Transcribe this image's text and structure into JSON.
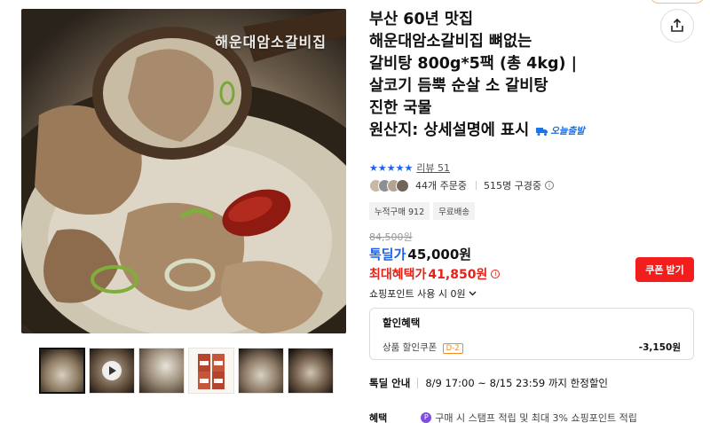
{
  "gallery": {
    "watermark": "해운대암소갈비집",
    "thumbnails": [
      {
        "name": "thumb-1",
        "active": true
      },
      {
        "name": "thumb-2-video",
        "active": false
      },
      {
        "name": "thumb-3",
        "active": false
      },
      {
        "name": "thumb-4",
        "active": false
      },
      {
        "name": "thumb-5",
        "active": false
      },
      {
        "name": "thumb-6",
        "active": false
      }
    ]
  },
  "product": {
    "title_lines": [
      "부산 60년 맛집",
      "해운대암소갈비집 뼈없는",
      "갈비탕 800g*5팩 (총 4kg) |",
      "살코기 듬뿍 순살 소 갈비탕",
      "진한 국물"
    ],
    "origin": "원산지: 상세설명에 표시",
    "today_badge": "오늘출발"
  },
  "rating": {
    "stars": "★★★★★",
    "review_label": "리뷰 51"
  },
  "buyers": {
    "orders": "44개 주문중",
    "subscribers": "515명 구경중"
  },
  "chips": [
    "누적구매 912",
    "무료배송"
  ],
  "price": {
    "original": "84,500원",
    "deal_label": "톡딜가",
    "deal_price": "45,000원",
    "max_label": "최대혜택가",
    "max_price": "41,850원",
    "coupon_button": "쿠폰 받기",
    "points": "쇼핑포인트 사용 시 0원"
  },
  "discount": {
    "title": "할인혜택",
    "item_label": "상품 할인쿠폰",
    "dday": "D-2",
    "amount": "-3,150원"
  },
  "special": {
    "label": "톡딜 안내",
    "text": "8/9 17:00 ~ 8/15 23:59 까지 한정할인"
  },
  "benefit": {
    "label": "혜택",
    "text": "구매 시 스탬프 적립 및 최대 3% 쇼핑포인트 적립"
  },
  "colors": {
    "accent_blue": "#1d63e8",
    "sale_red": "#e62117",
    "coupon_button": "#f21d1d"
  }
}
